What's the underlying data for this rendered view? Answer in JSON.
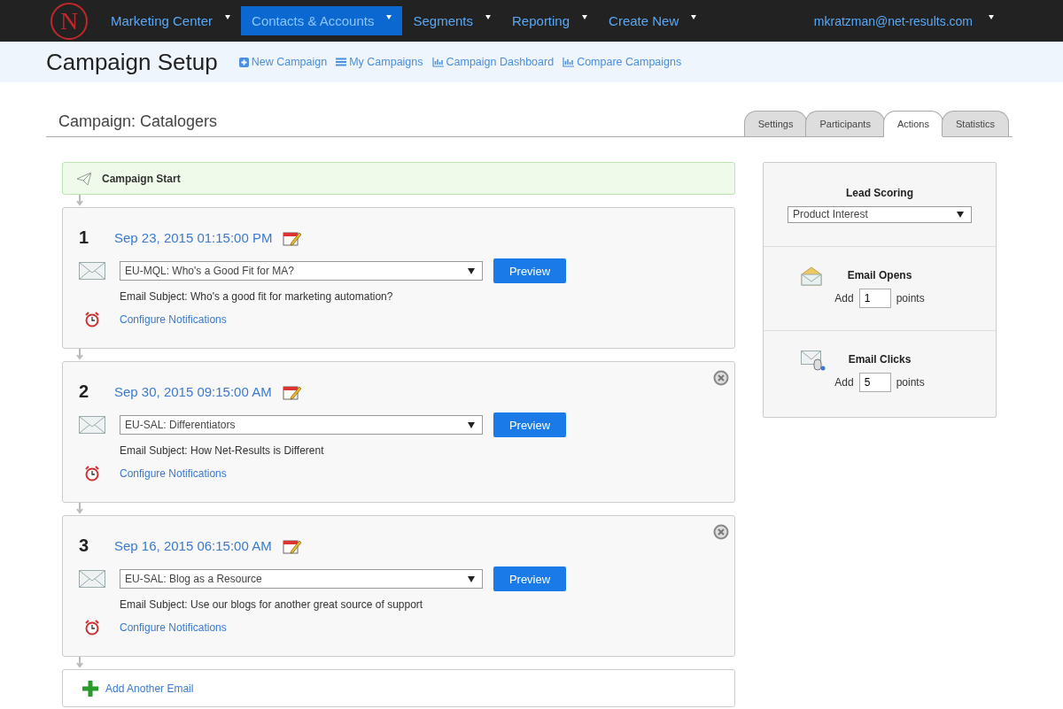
{
  "logo": {
    "letter": "N"
  },
  "nav": {
    "items": [
      {
        "label": "Marketing Center",
        "selected": false
      },
      {
        "label": "Contacts & Accounts",
        "selected": true
      },
      {
        "label": "Segments",
        "selected": false
      },
      {
        "label": "Reporting",
        "selected": false
      },
      {
        "label": "Create New",
        "selected": false
      }
    ],
    "user": "mkratzman@net-results.com"
  },
  "subheader": {
    "title": "Campaign Setup",
    "links": [
      {
        "label": "New Campaign",
        "kind": "plus"
      },
      {
        "label": "My Campaigns",
        "kind": "list"
      },
      {
        "label": "Campaign Dashboard",
        "kind": "chart"
      },
      {
        "label": "Compare Campaigns",
        "kind": "chart"
      }
    ]
  },
  "campaign": {
    "title": "Campaign: Catalogers"
  },
  "tabs": [
    {
      "label": "Settings",
      "selected": false
    },
    {
      "label": "Participants",
      "selected": false
    },
    {
      "label": "Actions",
      "selected": true
    },
    {
      "label": "Statistics",
      "selected": false
    }
  ],
  "start": {
    "label": "Campaign Start"
  },
  "steps": [
    {
      "number": "1",
      "date": "Sep 23, 2015 01:15:00 PM",
      "email": "EU-MQL: Who's a Good Fit for MA?",
      "button": "Preview",
      "subject": "Email Subject: Who's a good fit for marketing automation?",
      "notifications": "Configure Notifications",
      "removable": false
    },
    {
      "number": "2",
      "date": "Sep 30, 2015 09:15:00 AM",
      "email": "EU-SAL: Differentiators",
      "button": "Preview",
      "subject": "Email Subject: How Net-Results is Different",
      "notifications": "Configure Notifications",
      "removable": true
    },
    {
      "number": "3",
      "date": "Sep 16, 2015 06:15:00 AM",
      "email": "EU-SAL: Blog as a Resource",
      "button": "Preview",
      "subject": "Email Subject: Use our blogs for another great source of support",
      "notifications": "Configure Notifications",
      "removable": true
    }
  ],
  "add_email": "Add Another Email",
  "lead_scoring": {
    "title": "Lead Scoring",
    "select": "Product Interest",
    "rules": [
      {
        "kind": "opens",
        "title": "Email Opens",
        "prefix": "Add",
        "value": "1",
        "suffix": "points"
      },
      {
        "kind": "clicks",
        "title": "Email Clicks",
        "prefix": "Add",
        "value": "5",
        "suffix": "points"
      }
    ]
  }
}
